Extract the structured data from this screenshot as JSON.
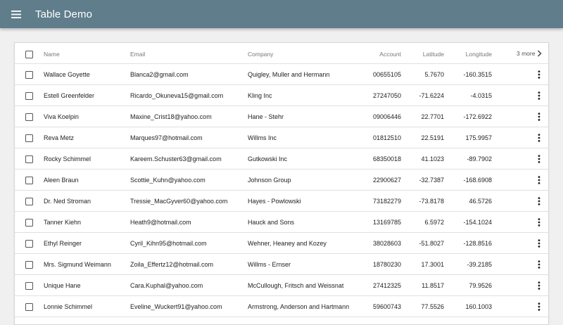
{
  "app": {
    "title": "Table Demo",
    "menu_icon": "hamburger-menu-icon",
    "bar_color": "#607d8b"
  },
  "table": {
    "columns": {
      "name": "Name",
      "email": "Email",
      "company": "Company",
      "account": "Account",
      "latitude": "Latitude",
      "longitude": "Longitude"
    },
    "more_columns_label": "3 more",
    "more_columns_icon": "chevron-right-icon",
    "row_action_icon": "more-vert-icon",
    "rows": [
      {
        "name": "Wallace Goyette",
        "email": "Blanca2@gmail.com",
        "company": "Quigley, Muller and Hermann",
        "account": "00655105",
        "latitude": "5.7670",
        "longitude": "-160.3515"
      },
      {
        "name": "Estell Greenfelder",
        "email": "Ricardo_Okuneva15@gmail.com",
        "company": "Kling Inc",
        "account": "27247050",
        "latitude": "-71.6224",
        "longitude": "-4.0315"
      },
      {
        "name": "Viva Koelpin",
        "email": "Maxine_Crist18@yahoo.com",
        "company": "Hane - Stehr",
        "account": "09006446",
        "latitude": "22.7701",
        "longitude": "-172.6922"
      },
      {
        "name": "Reva Metz",
        "email": "Marques97@hotmail.com",
        "company": "Willms Inc",
        "account": "01812510",
        "latitude": "22.5191",
        "longitude": "175.9957"
      },
      {
        "name": "Rocky Schimmel",
        "email": "Kareem.Schuster63@gmail.com",
        "company": "Gutkowski Inc",
        "account": "68350018",
        "latitude": "41.1023",
        "longitude": "-89.7902"
      },
      {
        "name": "Aleen Braun",
        "email": "Scottie_Kuhn@yahoo.com",
        "company": "Johnson Group",
        "account": "22900627",
        "latitude": "-32.7387",
        "longitude": "-168.6908"
      },
      {
        "name": "Dr. Ned Stroman",
        "email": "Tressie_MacGyver60@yahoo.com",
        "company": "Hayes - Powlowski",
        "account": "73182279",
        "latitude": "-73.8178",
        "longitude": "46.5726"
      },
      {
        "name": "Tanner Kiehn",
        "email": "Heath9@hotmail.com",
        "company": "Hauck and Sons",
        "account": "13169785",
        "latitude": "6.5972",
        "longitude": "-154.1024"
      },
      {
        "name": "Ethyl Reinger",
        "email": "Cyril_Kihn95@hotmail.com",
        "company": "Wehner, Heaney and Kozey",
        "account": "38028603",
        "latitude": "-51.8027",
        "longitude": "-128.8516"
      },
      {
        "name": "Mrs. Sigmund Weimann",
        "email": "Zoila_Effertz12@hotmail.com",
        "company": "Willms - Ernser",
        "account": "18780230",
        "latitude": "17.3001",
        "longitude": "-39.2185"
      },
      {
        "name": "Unique Hane",
        "email": "Cara.Kuphal@yahoo.com",
        "company": "McCullough, Fritsch and Weissnat",
        "account": "27412325",
        "latitude": "11.8517",
        "longitude": "79.9526"
      },
      {
        "name": "Lonnie Schimmel",
        "email": "Eveline_Wuckert91@yahoo.com",
        "company": "Armstrong, Anderson and Hartmann",
        "account": "59600743",
        "latitude": "77.5526",
        "longitude": "160.1003"
      }
    ]
  }
}
